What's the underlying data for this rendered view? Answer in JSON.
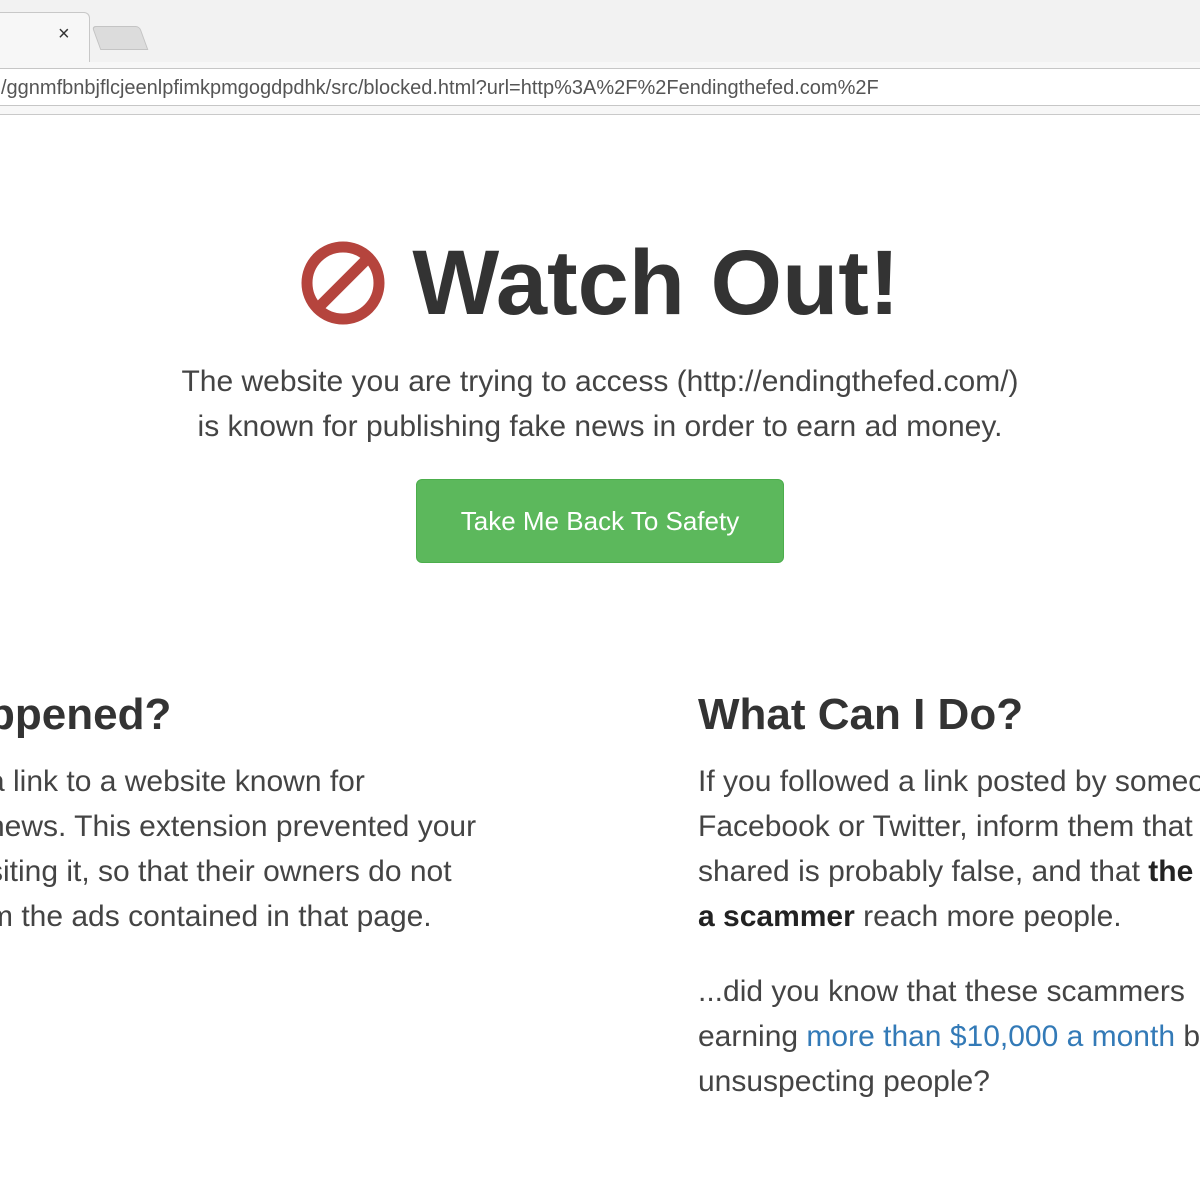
{
  "browser": {
    "tab": {
      "close_glyph": "×"
    },
    "address_bar": {
      "url": "/ggnmfbnbjflcjeenlpfimkpmgogdpdhk/src/blocked.html?url=http%3A%2F%2Fendingthefed.com%2F"
    }
  },
  "hero": {
    "icon": "no-entry-icon",
    "icon_color": "#b5443d",
    "title": "Watch Out!",
    "subtitle_line1": "The website you are trying to access (http://endingthefed.com/)",
    "subtitle_line2": "is known for publishing fake news in order to earn ad money.",
    "button_label": "Take Me Back To Safety",
    "button_color": "#5cb85c"
  },
  "left_column": {
    "heading": "ppened?",
    "lines": [
      "a link to a website known for",
      "news. This extension prevented your",
      "siting it, so that their owners do not",
      "m the ads contained in that page."
    ]
  },
  "right_column": {
    "heading": "What Can I Do?",
    "p1_line1": "If you followed a link posted by someo",
    "p1_line2": "Facebook or Twitter, inform them that",
    "p1_line3_pre": "shared is probably false, and that ",
    "p1_line3_bold": "the",
    "p1_line4_bold": "a scammer",
    "p1_line4_post": " reach more people.",
    "p2_line1": "...did you know that these scammers",
    "p2_line2_pre": "earning ",
    "p2_line2_link": "more than $10,000 a month",
    "p2_line2_post": " b",
    "p2_line3": "unsuspecting people?",
    "link_color": "#337ab7"
  }
}
